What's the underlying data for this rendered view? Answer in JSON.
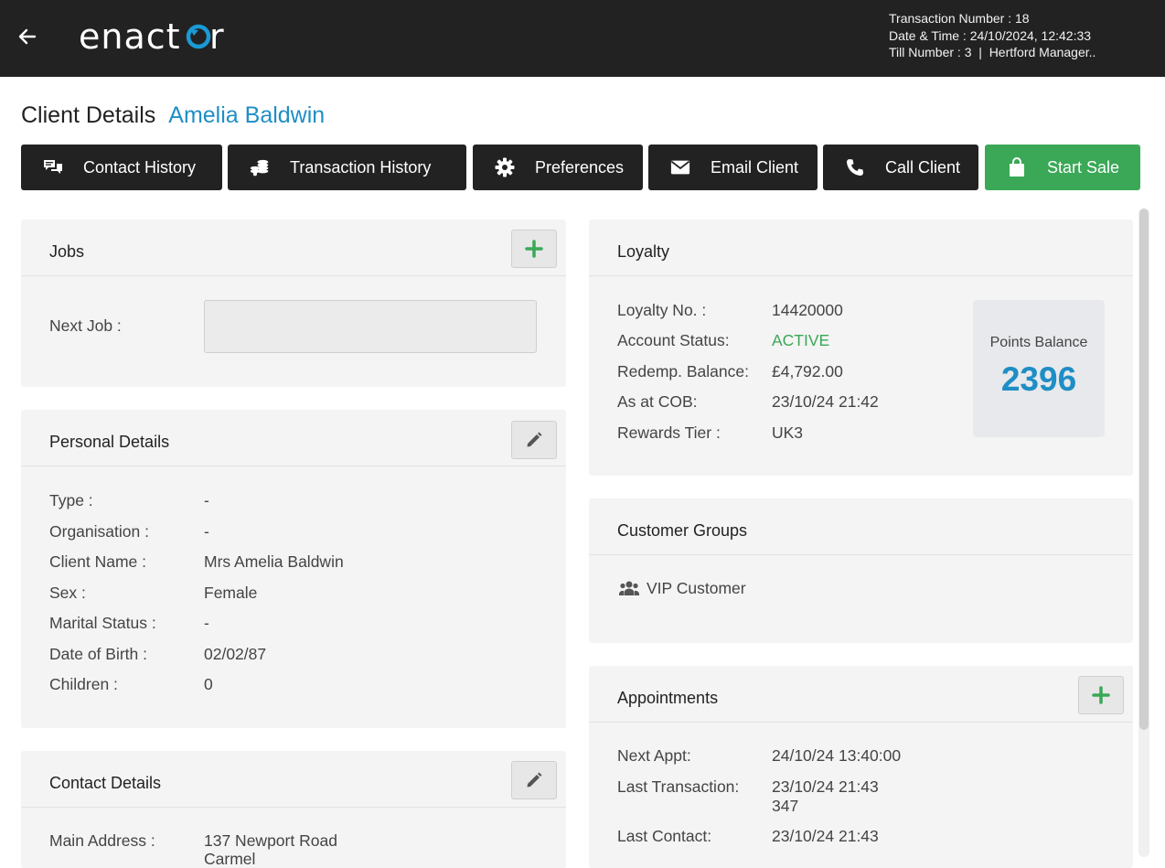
{
  "header": {
    "logo": "enactor",
    "transaction_number": "Transaction Number : 18",
    "date_time": "Date & Time : 24/10/2024, 12:42:33",
    "till": "Till Number : 3  |  Hertford Manager.."
  },
  "page": {
    "title": "Client Details",
    "client_name": "Amelia Baldwin"
  },
  "actions": [
    {
      "label": "Contact History",
      "icon": "chat-icon"
    },
    {
      "label": "Transaction History",
      "icon": "coins-icon"
    },
    {
      "label": "Preferences",
      "icon": "gear-icon"
    },
    {
      "label": "Email Client",
      "icon": "envelope-icon"
    },
    {
      "label": "Call Client",
      "icon": "phone-icon"
    },
    {
      "label": "Start Sale",
      "icon": "shopping-bag-icon"
    }
  ],
  "jobs": {
    "title": "Jobs",
    "next_job_label": "Next Job :",
    "next_job_value": ""
  },
  "personal": {
    "title": "Personal Details",
    "rows": [
      {
        "label": "Type :",
        "value": "-"
      },
      {
        "label": "Organisation :",
        "value": "-"
      },
      {
        "label": "Client Name :",
        "value": "Mrs Amelia Baldwin"
      },
      {
        "label": "Sex :",
        "value": "Female"
      },
      {
        "label": "Marital Status :",
        "value": "-"
      },
      {
        "label": "Date of Birth :",
        "value": "02/02/87"
      },
      {
        "label": "Children :",
        "value": "0"
      }
    ]
  },
  "contact": {
    "title": "Contact Details",
    "main_address_label": "Main Address :",
    "main_address_line1": "137 Newport Road",
    "main_address_line2": "Carmel"
  },
  "loyalty": {
    "title": "Loyalty",
    "rows": [
      {
        "label": "Loyalty No. :",
        "value": "14420000"
      },
      {
        "label": "Account Status:",
        "value": "ACTIVE"
      },
      {
        "label": "Redemp. Balance:",
        "value": "£4,792.00"
      },
      {
        "label": "As at COB:",
        "value": "23/10/24 21:42"
      },
      {
        "label": "Rewards Tier :",
        "value": "UK3"
      }
    ],
    "points_label": "Points Balance",
    "points_value": "2396",
    "status_color": "#3aa857",
    "accent_color": "#1f8ec5"
  },
  "groups": {
    "title": "Customer Groups",
    "items": [
      "VIP Customer"
    ]
  },
  "appointments": {
    "title": "Appointments",
    "next_appt_label": "Next Appt:",
    "next_appt_value": "24/10/24 13:40:00",
    "last_tx_label": "Last Transaction:",
    "last_tx_value": "23/10/24 21:43",
    "last_tx_id": "347",
    "last_contact_label": "Last Contact:",
    "last_contact_value": "23/10/24 21:43"
  }
}
